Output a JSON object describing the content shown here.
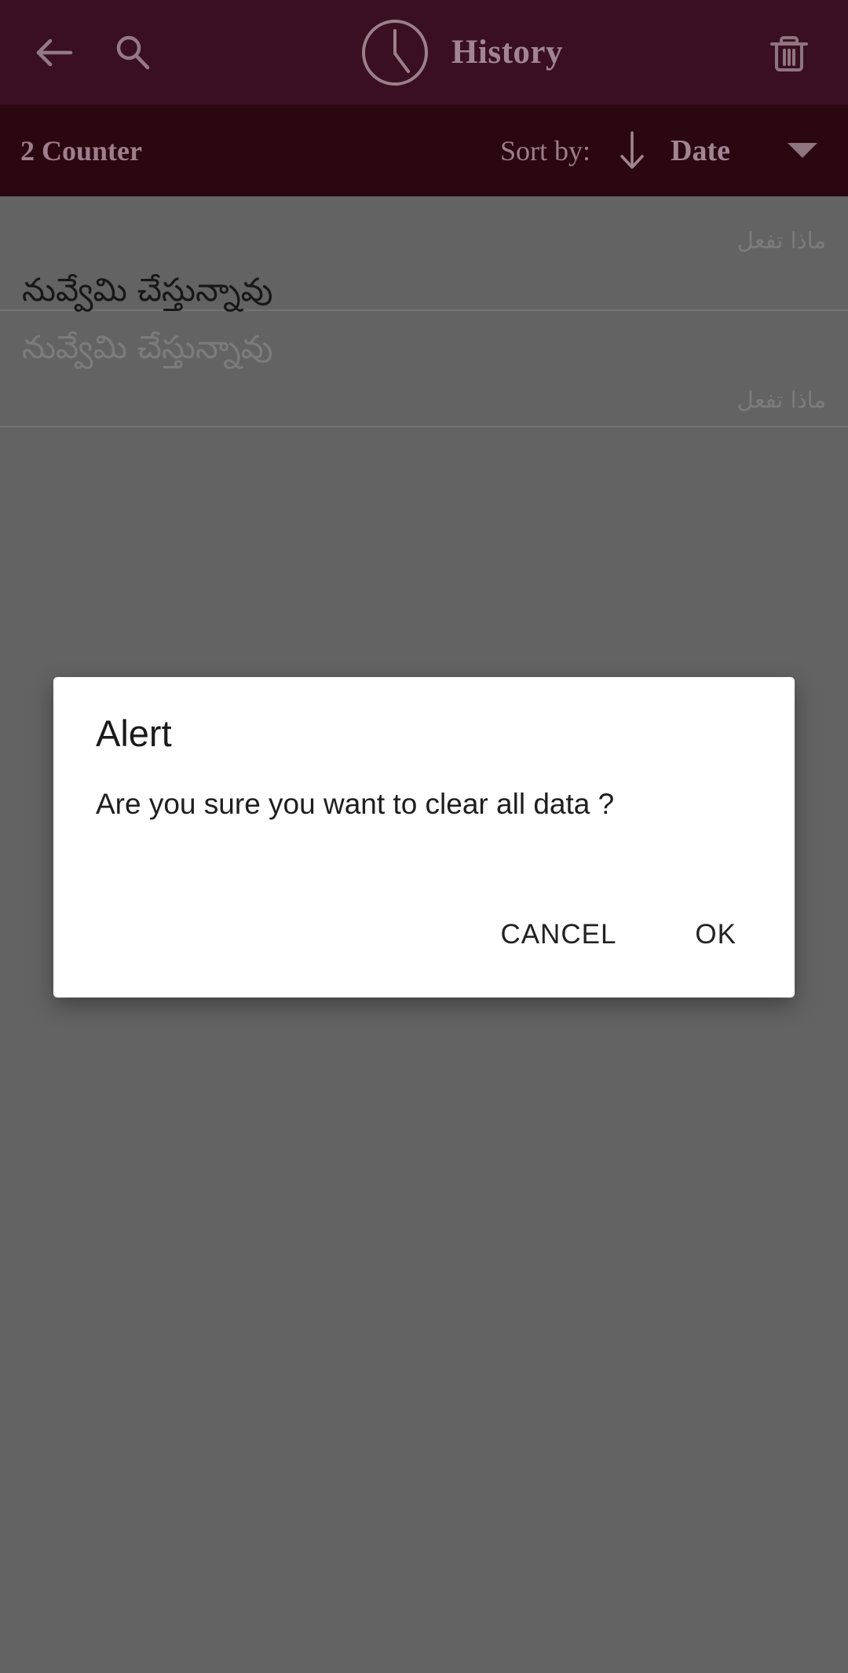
{
  "app_bar": {
    "back_icon": "back-arrow-icon",
    "search_icon": "search-icon",
    "clock_icon": "clock-icon",
    "title": "History",
    "delete_icon": "trash-icon"
  },
  "sort_bar": {
    "counter_label": "2 Counter",
    "sort_by_label": "Sort by:",
    "sort_direction_icon": "arrow-down-icon",
    "sort_field": "Date",
    "dropdown_icon": "chevron-down-icon"
  },
  "list": {
    "items": [
      {
        "subtitle": "ماذا تفعل",
        "title": "నువ్వేమి చేస్తున్నావు"
      },
      {
        "title": "నువ్వేమి చేస్తున్నావు",
        "subtitle": "ماذا تفعل"
      }
    ]
  },
  "dialog": {
    "title": "Alert",
    "message": "Are you sure you want to clear all data ?",
    "cancel_label": "CANCEL",
    "ok_label": "OK"
  },
  "colors": {
    "app_bar_bg": "#3B0F22",
    "sort_bar_bg": "#2B0712",
    "app_bar_text": "#A18692",
    "scrim": "#636363",
    "dialog_bg": "#FFFFFF",
    "dialog_text": "#1A1A1A"
  }
}
